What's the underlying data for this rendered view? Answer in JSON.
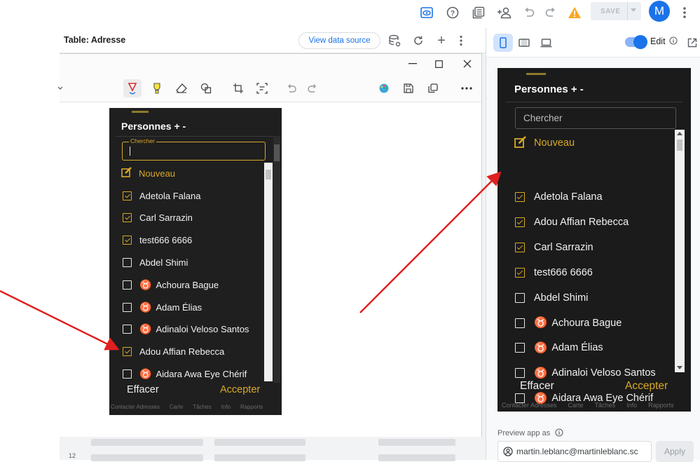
{
  "topbar": {
    "save_label": "SAVE",
    "avatar_letter": "M",
    "icons": [
      "preview-icon",
      "help-icon",
      "gallery-icon",
      "add-person-icon",
      "undo-icon",
      "redo-icon",
      "warning-icon",
      "more-vert-icon"
    ]
  },
  "table": {
    "title": "Table: Adresse",
    "view_data_source": "View data source",
    "row_number": "12"
  },
  "left_app": {
    "title": "Personnes + -",
    "search_label": "Chercher",
    "new_label": "Nouveau",
    "items": [
      {
        "label": "Adetola Falana",
        "checked": true,
        "symbol": false
      },
      {
        "label": "Carl Sarrazin",
        "checked": true,
        "symbol": false
      },
      {
        "label": "test666 6666",
        "checked": true,
        "symbol": false
      },
      {
        "label": "Abdel Shimi",
        "checked": false,
        "symbol": false
      },
      {
        "label": "Achoura Bague",
        "checked": false,
        "symbol": true
      },
      {
        "label": "Adam Élias",
        "checked": false,
        "symbol": true
      },
      {
        "label": "Adinaloi Veloso Santos",
        "checked": false,
        "symbol": true
      },
      {
        "label": "Adou Affian Rebecca",
        "checked": true,
        "symbol": false
      },
      {
        "label": "Aidara Awa Eye Chérif",
        "checked": false,
        "symbol": true
      }
    ],
    "clear_label": "Effacer",
    "accept_label": "Accepter",
    "tabs": [
      "Contacter Adresses",
      "Carte",
      "Tâches",
      "Info",
      "Rapports"
    ]
  },
  "right_app": {
    "title": "Personnes + -",
    "search_placeholder": "Chercher",
    "new_label": "Nouveau",
    "items": [
      {
        "label": "Adetola Falana",
        "checked": true,
        "symbol": false
      },
      {
        "label": "Adou Affian Rebecca",
        "checked": true,
        "symbol": false
      },
      {
        "label": "Carl Sarrazin",
        "checked": true,
        "symbol": false
      },
      {
        "label": "test666 6666",
        "checked": true,
        "symbol": false
      },
      {
        "label": "Abdel Shimi",
        "checked": false,
        "symbol": false
      },
      {
        "label": "Achoura Bague",
        "checked": false,
        "symbol": true
      },
      {
        "label": "Adam Élias",
        "checked": false,
        "symbol": true
      },
      {
        "label": "Adinaloi Veloso Santos",
        "checked": false,
        "symbol": true
      },
      {
        "label": "Aidara Awa Eye Chérif",
        "checked": false,
        "symbol": true
      }
    ],
    "clear_label": "Effacer",
    "accept_label": "Accepter",
    "tabs": [
      "Contacter Adresses",
      "Carte",
      "Tâches",
      "Info",
      "Rapports"
    ]
  },
  "right_panel": {
    "edit_label": "Edit",
    "preview_as_label": "Preview app as",
    "preview_email": "martin.leblanc@martinleblanc.sc",
    "apply_label": "Apply"
  },
  "colors": {
    "accent": "#d7a928",
    "app_bg": "#1f1f1f",
    "symbol": "#e24a94",
    "arrow": "#e02020",
    "link": "#1a73e8"
  }
}
